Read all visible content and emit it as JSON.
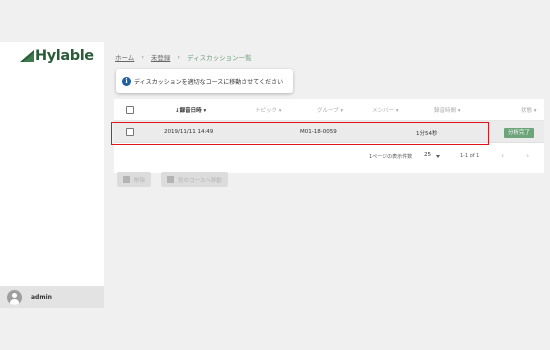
{
  "brand": {
    "name": "Hylable",
    "color": "#2a5c39"
  },
  "user": {
    "name": "admin",
    "icon": "account-circle-icon"
  },
  "breadcrumb": [
    {
      "label": "ホーム"
    },
    {
      "label": "未登録"
    },
    {
      "label": "ディスカッション一覧"
    }
  ],
  "breadcrumb_separator": "›",
  "toast": {
    "icon": "info-icon",
    "glyph": "i",
    "text": "ディスカッションを適切なコースに移動させてください"
  },
  "table": {
    "columns": [
      {
        "label": "録音日時",
        "sort": "↓",
        "active": true
      },
      {
        "label": "トピック",
        "active": false
      },
      {
        "label": "グループ",
        "active": false
      },
      {
        "label": "メンバー",
        "active": false
      },
      {
        "label": "録音時間",
        "active": false
      },
      {
        "label": "状態",
        "active": false
      }
    ],
    "rows": [
      {
        "recorded_at": "2019/11/11 14:49",
        "topic": "",
        "group": "M01-18-0059",
        "members": "",
        "duration": "1分54秒",
        "status": "分析完了"
      }
    ]
  },
  "pagination": {
    "rows_per_page_label": "1ページの表示件数",
    "rows_per_page": "25",
    "range": "1-1 of 1",
    "prev": "‹",
    "next": "›"
  },
  "actions": {
    "delete_label": "削除",
    "move_label": "別のコースへ移動"
  },
  "colors": {
    "accent": "#6ea47a",
    "highlight": "#e0141b",
    "info": "#1f5fa6"
  }
}
